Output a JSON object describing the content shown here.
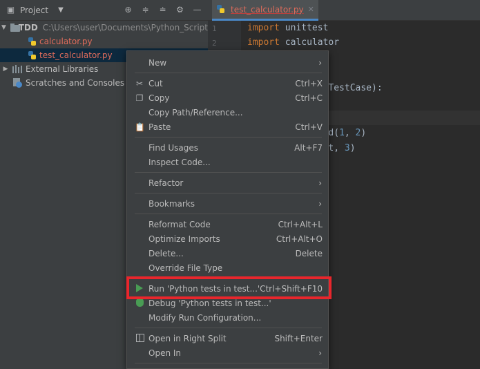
{
  "project_panel": {
    "title": "Project",
    "tree": {
      "root_name": "TDD",
      "root_path": "C:\\Users\\user\\Documents\\Python_Script",
      "files": [
        "calculator.py",
        "test_calculator.py"
      ],
      "external_libraries": "External Libraries",
      "scratches": "Scratches and Consoles"
    }
  },
  "editor": {
    "tab_label": "test_calculator.py",
    "line_numbers": [
      "1",
      "2"
    ]
  },
  "context_menu": {
    "items": [
      {
        "label": "New",
        "shortcut": "",
        "submenu": true
      },
      {
        "label": "Cut",
        "shortcut": "Ctrl+X"
      },
      {
        "label": "Copy",
        "shortcut": "Ctrl+C"
      },
      {
        "label": "Copy Path/Reference...",
        "shortcut": ""
      },
      {
        "label": "Paste",
        "shortcut": "Ctrl+V"
      },
      {
        "label": "Find Usages",
        "shortcut": "Alt+F7"
      },
      {
        "label": "Inspect Code...",
        "shortcut": ""
      },
      {
        "label": "Refactor",
        "shortcut": "",
        "submenu": true
      },
      {
        "label": "Bookmarks",
        "shortcut": "",
        "submenu": true
      },
      {
        "label": "Reformat Code",
        "shortcut": "Ctrl+Alt+L"
      },
      {
        "label": "Optimize Imports",
        "shortcut": "Ctrl+Alt+O"
      },
      {
        "label": "Delete...",
        "shortcut": "Delete"
      },
      {
        "label": "Override File Type",
        "shortcut": ""
      },
      {
        "label": "Run 'Python tests in test...'",
        "shortcut": "Ctrl+Shift+F10"
      },
      {
        "label": "Debug 'Python tests in test...'",
        "shortcut": ""
      },
      {
        "label": "Modify Run Configuration...",
        "shortcut": ""
      },
      {
        "label": "Open in Right Split",
        "shortcut": "Shift+Enter"
      },
      {
        "label": "Open In",
        "shortcut": "",
        "submenu": true
      }
    ]
  },
  "colors": {
    "highlight_box": "#e8262c",
    "run_icon": "#499c54",
    "file_red": "#e06c5b"
  }
}
